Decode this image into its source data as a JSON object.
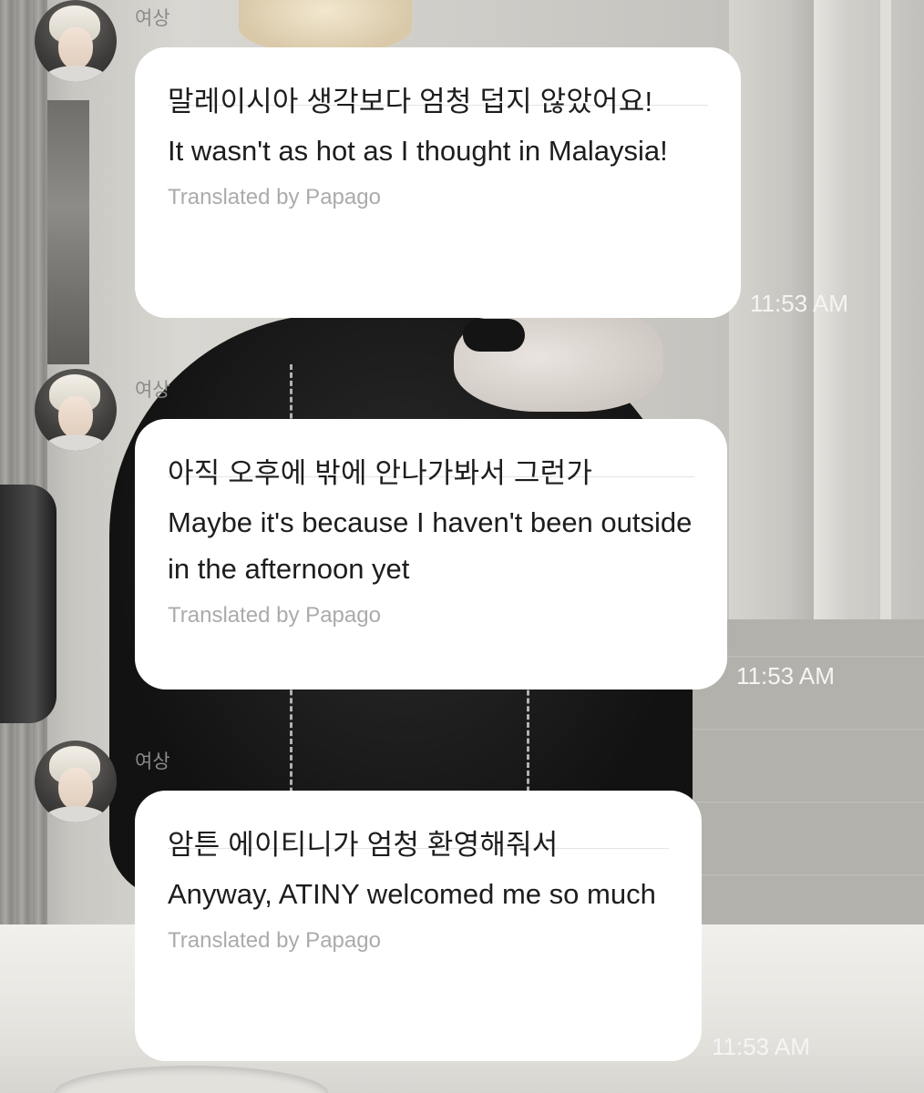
{
  "messages": [
    {
      "sender": "여상",
      "korean": "말레이시아 생각보다 엄청 덥지 않았어요!",
      "english": "It wasn't as hot as I thought in Malaysia!",
      "credit": "Translated by Papago",
      "time": "11:53 AM"
    },
    {
      "sender": "여상",
      "korean": "아직 오후에 밖에 안나가봐서 그런가",
      "english": "Maybe it's because I haven't been outside in the afternoon yet",
      "credit": "Translated by Papago",
      "time": "11:53 AM"
    },
    {
      "sender": "여상",
      "korean": "암튼 에이티니가 엄청 환영해줘서",
      "english": "Anyway, ATINY welcomed me so much",
      "credit": "Translated by Papago",
      "time": "11:53 AM"
    }
  ]
}
